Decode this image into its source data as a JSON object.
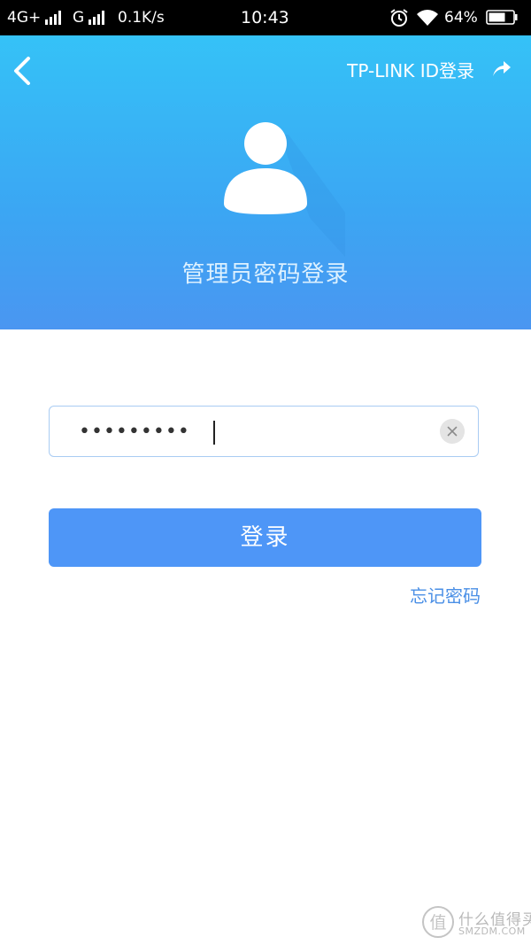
{
  "status_bar": {
    "network_primary": "4G+",
    "network_secondary": "G",
    "speed": "0.1K/s",
    "time": "10:43",
    "battery": "64%",
    "icons": [
      "signal-icon",
      "alarm-icon",
      "wifi-icon",
      "battery-icon"
    ]
  },
  "header": {
    "back_icon": "back-arrow-icon",
    "tplink_link": "TP-LINK ID登录",
    "share_icon": "switch-arrow-icon",
    "avatar_icon": "user-avatar-icon",
    "title": "管理员密码登录",
    "gradient": [
      "#35c2f7",
      "#4a96f1"
    ]
  },
  "form": {
    "password_value": "•••••••••",
    "clear_icon": "clear-icon",
    "login_label": "登录",
    "forgot_label": "忘记密码"
  },
  "colors": {
    "accent": "#4e96f7",
    "link": "#4a8fe6",
    "field_border": "#a9ccf3"
  },
  "watermark": {
    "text_cn": "什么值得买",
    "text_en": "SMZDM.COM",
    "logo_glyph": "值"
  }
}
